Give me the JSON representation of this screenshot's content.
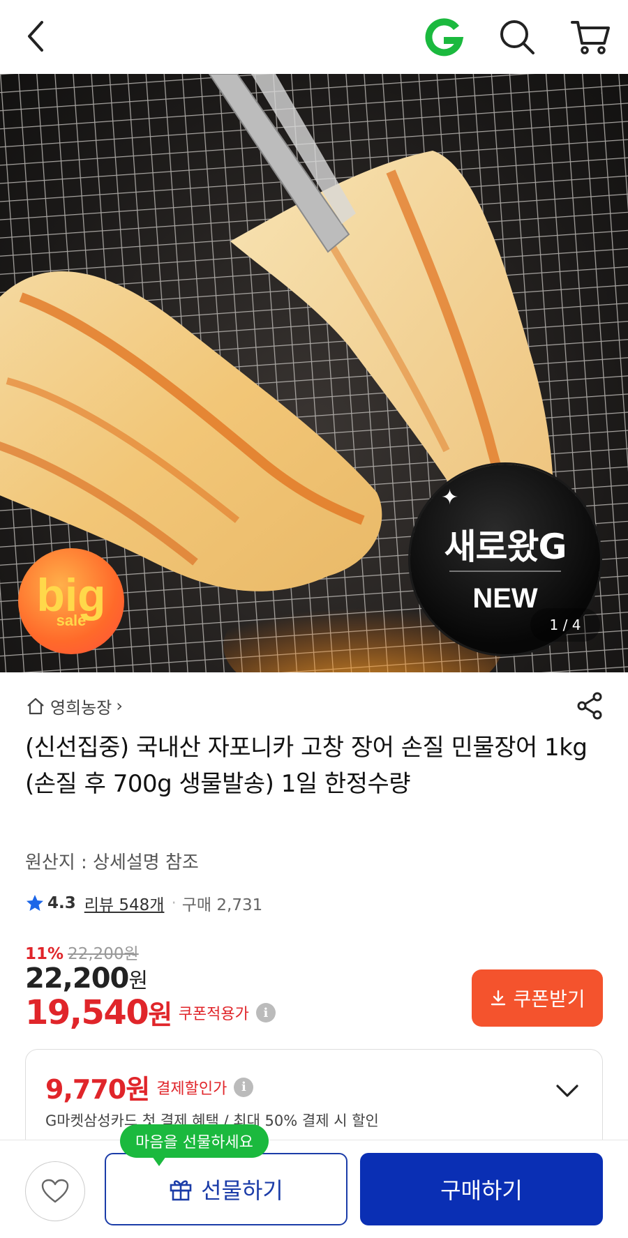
{
  "header": {
    "back_icon": "chevron-left-icon",
    "logo_icon": "gmarket-g-logo",
    "search_icon": "search-icon",
    "cart_icon": "cart-icon"
  },
  "hero": {
    "badge_big": "big",
    "badge_sale": "sale",
    "new_badge_title": "새로왔G",
    "new_badge_sub": "NEW",
    "pager": "1 / 4"
  },
  "product": {
    "store": "영희농장",
    "store_chevron": "›",
    "title": "(신선집중) 국내산 자포니카 고창 장어 손질 민물장어 1kg (손질 후 700g 생물발송) 1일 한정수량",
    "origin": "원산지 : 상세설명 참조",
    "rating": "4.3",
    "review": "리뷰 548개",
    "purchases": "구매 2,731"
  },
  "price": {
    "discount_pct": "11%",
    "original": "22,200",
    "original_unit": "원",
    "current": "22,200",
    "current_unit": "원",
    "coupon_price": "19,540",
    "coupon_unit": "원",
    "coupon_label": "쿠폰적용가",
    "coupon_button": "쿠폰받기"
  },
  "card_pay": {
    "amount": "9,770원",
    "label": "결제할인가",
    "description": "G마켓삼성카드 첫 결제 혜택 / 최대 50% 결제 시 할인"
  },
  "bottom": {
    "tooltip": "마음을 선물하세요",
    "gift_label": "선물하기",
    "buy_label": "구매하기"
  },
  "colors": {
    "accent_red": "#e0252a",
    "coupon_orange": "#f4532d",
    "buy_blue": "#0a2fb4",
    "tooltip_green": "#1bb93e",
    "gmarket_green": "#1bb93e"
  }
}
